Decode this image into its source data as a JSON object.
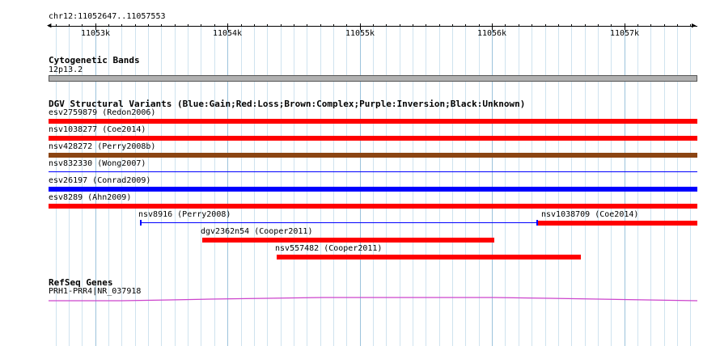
{
  "ruler": {
    "location": "chr12:11052647..11057553",
    "start": 11052647,
    "end": 11057553,
    "ticks": [
      {
        "pos": 11053000,
        "label": "11053k"
      },
      {
        "pos": 11054000,
        "label": "11054k"
      },
      {
        "pos": 11055000,
        "label": "11055k"
      },
      {
        "pos": 11056000,
        "label": "11056k"
      },
      {
        "pos": 11057000,
        "label": "11057k"
      }
    ]
  },
  "cytoband": {
    "title": "Cytogenetic Bands",
    "band": "12p13.2",
    "color": "#b0b0b0"
  },
  "dgv": {
    "title": "DGV Structural Variants (Blue:Gain;Red:Loss;Brown:Complex;Purple:Inversion;Black:Unknown)",
    "colors": {
      "loss": "#ff0000",
      "gain": "#0000ff",
      "complex": "#8b4513"
    },
    "variants": [
      {
        "label": "esv2759879 (Redon2006)",
        "type": "loss",
        "style": "thick",
        "start": 11052647,
        "end": 11057553
      },
      {
        "label": "nsv1038277 (Coe2014)",
        "type": "loss",
        "style": "thick",
        "start": 11052647,
        "end": 11057553
      },
      {
        "label": "nsv428272 (Perry2008b)",
        "type": "complex",
        "style": "thick",
        "start": 11052647,
        "end": 11057553
      },
      {
        "label": "nsv832330 (Wong2007)",
        "type": "gain",
        "style": "thin",
        "start": 11052647,
        "end": 11057553
      },
      {
        "label": "esv26197 (Conrad2009)",
        "type": "gain",
        "style": "thick",
        "start": 11052647,
        "end": 11057553
      },
      {
        "label": "esv8289 (Ahn2009)",
        "type": "loss",
        "style": "thick",
        "start": 11052647,
        "end": 11057553
      },
      {
        "label": "nsv8916 (Perry2008)",
        "type": "gain",
        "style": "thin",
        "start": 11053340,
        "end": 11056340
      },
      {
        "label": "nsv1038709 (Coe2014)",
        "type": "loss",
        "style": "thick",
        "start": 11056350,
        "end": 11057553
      },
      {
        "label": "dgv2362n54 (Cooper2011)",
        "type": "loss",
        "style": "thick",
        "start": 11053810,
        "end": 11056020
      },
      {
        "label": "nsv557482 (Cooper2011)",
        "type": "loss",
        "style": "thick",
        "start": 11054370,
        "end": 11056670
      }
    ]
  },
  "refseq": {
    "title": "RefSeq Genes",
    "gene": "PRH1-PRR4|NR_037918",
    "color": "#cc44cc"
  }
}
